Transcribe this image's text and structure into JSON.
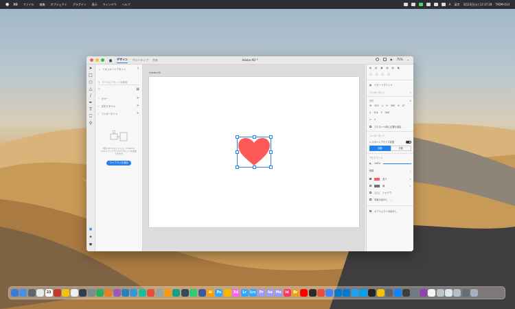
{
  "menubar": {
    "apple": "",
    "app_name": "XD",
    "items": [
      "ファイル",
      "編集",
      "オブジェクト",
      "プラグイン",
      "表示",
      "ウィンドウ",
      "ヘルプ"
    ],
    "status": [
      "A",
      "英字",
      "3月23日(火) 12:37:28",
      "TADM-014"
    ]
  },
  "window": {
    "tabs": [
      "デザイン",
      "プロトタイプ",
      "共有"
    ],
    "title": "Adobe-XD *",
    "zoom": "75%"
  },
  "left_panel": {
    "header": "ドキュメントアセット",
    "search_placeholder": "すべてのアセットを検索",
    "sections": [
      "カラー",
      "文字スタイル",
      "コンポーネント"
    ],
    "empty_text": "他の XD ドキュメント、Creative Cloud ライブラリからアセットを追加できます",
    "button": "ライブラリを追加"
  },
  "canvas": {
    "artboard_label": "Adobe-XD",
    "heart_color": "#ff5a5a",
    "selection_color": "#2680eb"
  },
  "right_panel": {
    "component_label": "コンポーネント",
    "repeat_grid": "リピートグリッド",
    "component_section": "コンポーネント",
    "transform_label": "変形",
    "w_label": "W",
    "w_value": "323",
    "h_label": "H",
    "h_value": "365",
    "rotation": "0°",
    "x_label": "X",
    "x_value": "324",
    "y_label": "Y",
    "y_value": "309",
    "scroll_label": "スクロール時に位置を固定",
    "responsive_label": "レスポンシブサイズ変更",
    "auto": "自動",
    "manual": "手動",
    "appearance_label": "アピアランス",
    "opacity": "100%",
    "blend": "標準",
    "fill_label": "塗り",
    "stroke_label": "線",
    "shadow_label": "シャドウ",
    "bg_blur_label": "背景のぼかし",
    "object_blur_label": "オブジェクトのぼかし",
    "fill_color": "#ff5a5a",
    "stroke_color": "#707070"
  },
  "dock": {
    "apps": [
      {
        "label": "",
        "color": "#3a7bd5"
      },
      {
        "label": "",
        "color": "#4a90e2"
      },
      {
        "label": "",
        "color": "#5b6770"
      },
      {
        "label": "",
        "color": "#e8e8e8"
      },
      {
        "label": "23",
        "color": "#ffffff"
      },
      {
        "label": "",
        "color": "#c0392b"
      },
      {
        "label": "",
        "color": "#f1c40f"
      },
      {
        "label": "",
        "color": "#ecf0f1"
      },
      {
        "label": "",
        "color": "#2c3e50"
      },
      {
        "label": "",
        "color": "#7f8c8d"
      },
      {
        "label": "",
        "color": "#27ae60"
      },
      {
        "label": "",
        "color": "#e67e22"
      },
      {
        "label": "",
        "color": "#9b59b6"
      },
      {
        "label": "",
        "color": "#2980b9"
      },
      {
        "label": "",
        "color": "#3498db"
      },
      {
        "label": "",
        "color": "#1abc9c"
      },
      {
        "label": "",
        "color": "#e74c3c"
      },
      {
        "label": "",
        "color": "#95a5a6"
      },
      {
        "label": "",
        "color": "#f39c12"
      },
      {
        "label": "",
        "color": "#16a085"
      },
      {
        "label": "",
        "color": "#34495e"
      },
      {
        "label": "",
        "color": "#2ecc71"
      },
      {
        "label": "",
        "color": "#3b5998"
      },
      {
        "label": "Ai",
        "color": "#ff9a00"
      },
      {
        "label": "Ps",
        "color": "#31a8ff"
      },
      {
        "label": "",
        "color": "#f7b500"
      },
      {
        "label": "Xd",
        "color": "#ff61f6"
      },
      {
        "label": "Lr",
        "color": "#31a8ff"
      },
      {
        "label": "Lrc",
        "color": "#31a8ff"
      },
      {
        "label": "Pr",
        "color": "#9999ff"
      },
      {
        "label": "Ae",
        "color": "#9999ff"
      },
      {
        "label": "Me",
        "color": "#9999ff"
      },
      {
        "label": "Id",
        "color": "#ff3366"
      },
      {
        "label": "Br",
        "color": "#e8a317"
      },
      {
        "label": "",
        "color": "#ff0000"
      },
      {
        "label": "",
        "color": "#2b2b2b"
      },
      {
        "label": "",
        "color": "#e74c3c"
      },
      {
        "label": "",
        "color": "#4285f4"
      },
      {
        "label": "",
        "color": "#007acc"
      },
      {
        "label": "",
        "color": "#0078d4"
      },
      {
        "label": "",
        "color": "#1da1f2"
      },
      {
        "label": "",
        "color": "#00a2ed"
      },
      {
        "label": "",
        "color": "#222222"
      },
      {
        "label": "",
        "color": "#f4c20d"
      },
      {
        "label": "",
        "color": "#5f6368"
      },
      {
        "label": "",
        "color": "#0b84ff"
      },
      {
        "label": "",
        "color": "#3d3d3d"
      },
      {
        "label": "",
        "color": "#6c7a89"
      },
      {
        "label": "",
        "color": "#8e44ad"
      },
      {
        "label": "",
        "color": "#f5f5f5"
      },
      {
        "label": "",
        "color": "#bdc3c7"
      },
      {
        "label": "",
        "color": "#dfe6e9"
      },
      {
        "label": "",
        "color": "#b2bec3"
      },
      {
        "label": "",
        "color": "#636e72"
      },
      {
        "label": "",
        "color": "#a4b0be"
      }
    ]
  }
}
